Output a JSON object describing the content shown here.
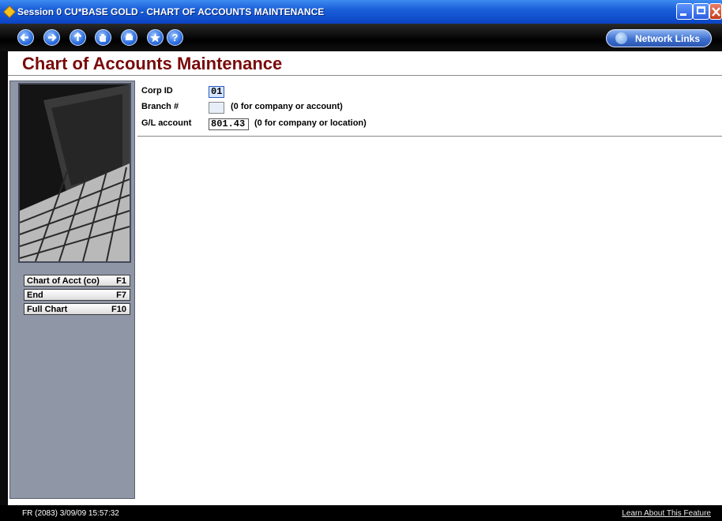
{
  "window": {
    "title": "Session 0 CU*BASE GOLD - CHART OF ACCOUNTS MAINTENANCE"
  },
  "toolbar": {
    "nav_buttons": [
      {
        "icon": "back-arrow-icon"
      },
      {
        "icon": "forward-arrow-icon"
      },
      {
        "icon": "up-arrow-icon"
      },
      {
        "icon": "hand-icon"
      },
      {
        "icon": "print-icon"
      },
      {
        "icon": "star-icon"
      },
      {
        "icon": "help-icon",
        "glyph": "?"
      }
    ],
    "network_links_label": "Network Links"
  },
  "page": {
    "title": "Chart of Accounts Maintenance"
  },
  "form": {
    "corp_id_label": "Corp ID",
    "corp_id_value": "01",
    "branch_label": "Branch #",
    "branch_value": "",
    "branch_hint": "(0 for company or account)",
    "gl_label": "G/L account",
    "gl_value": "801.43",
    "gl_hint": "(0 for company or location)"
  },
  "function_keys": [
    {
      "label": "Chart of Acct (co)",
      "key": "F1"
    },
    {
      "label": "End",
      "key": "F7"
    },
    {
      "label": "Full Chart",
      "key": "F10"
    }
  ],
  "status": {
    "left": "FR (2083) 3/09/09 15:57:32",
    "right": "Learn About This Feature"
  },
  "colors": {
    "title_red": "#7a0a0a",
    "xp_blue": "#0b44c4",
    "sidebar": "#8f96a6"
  }
}
